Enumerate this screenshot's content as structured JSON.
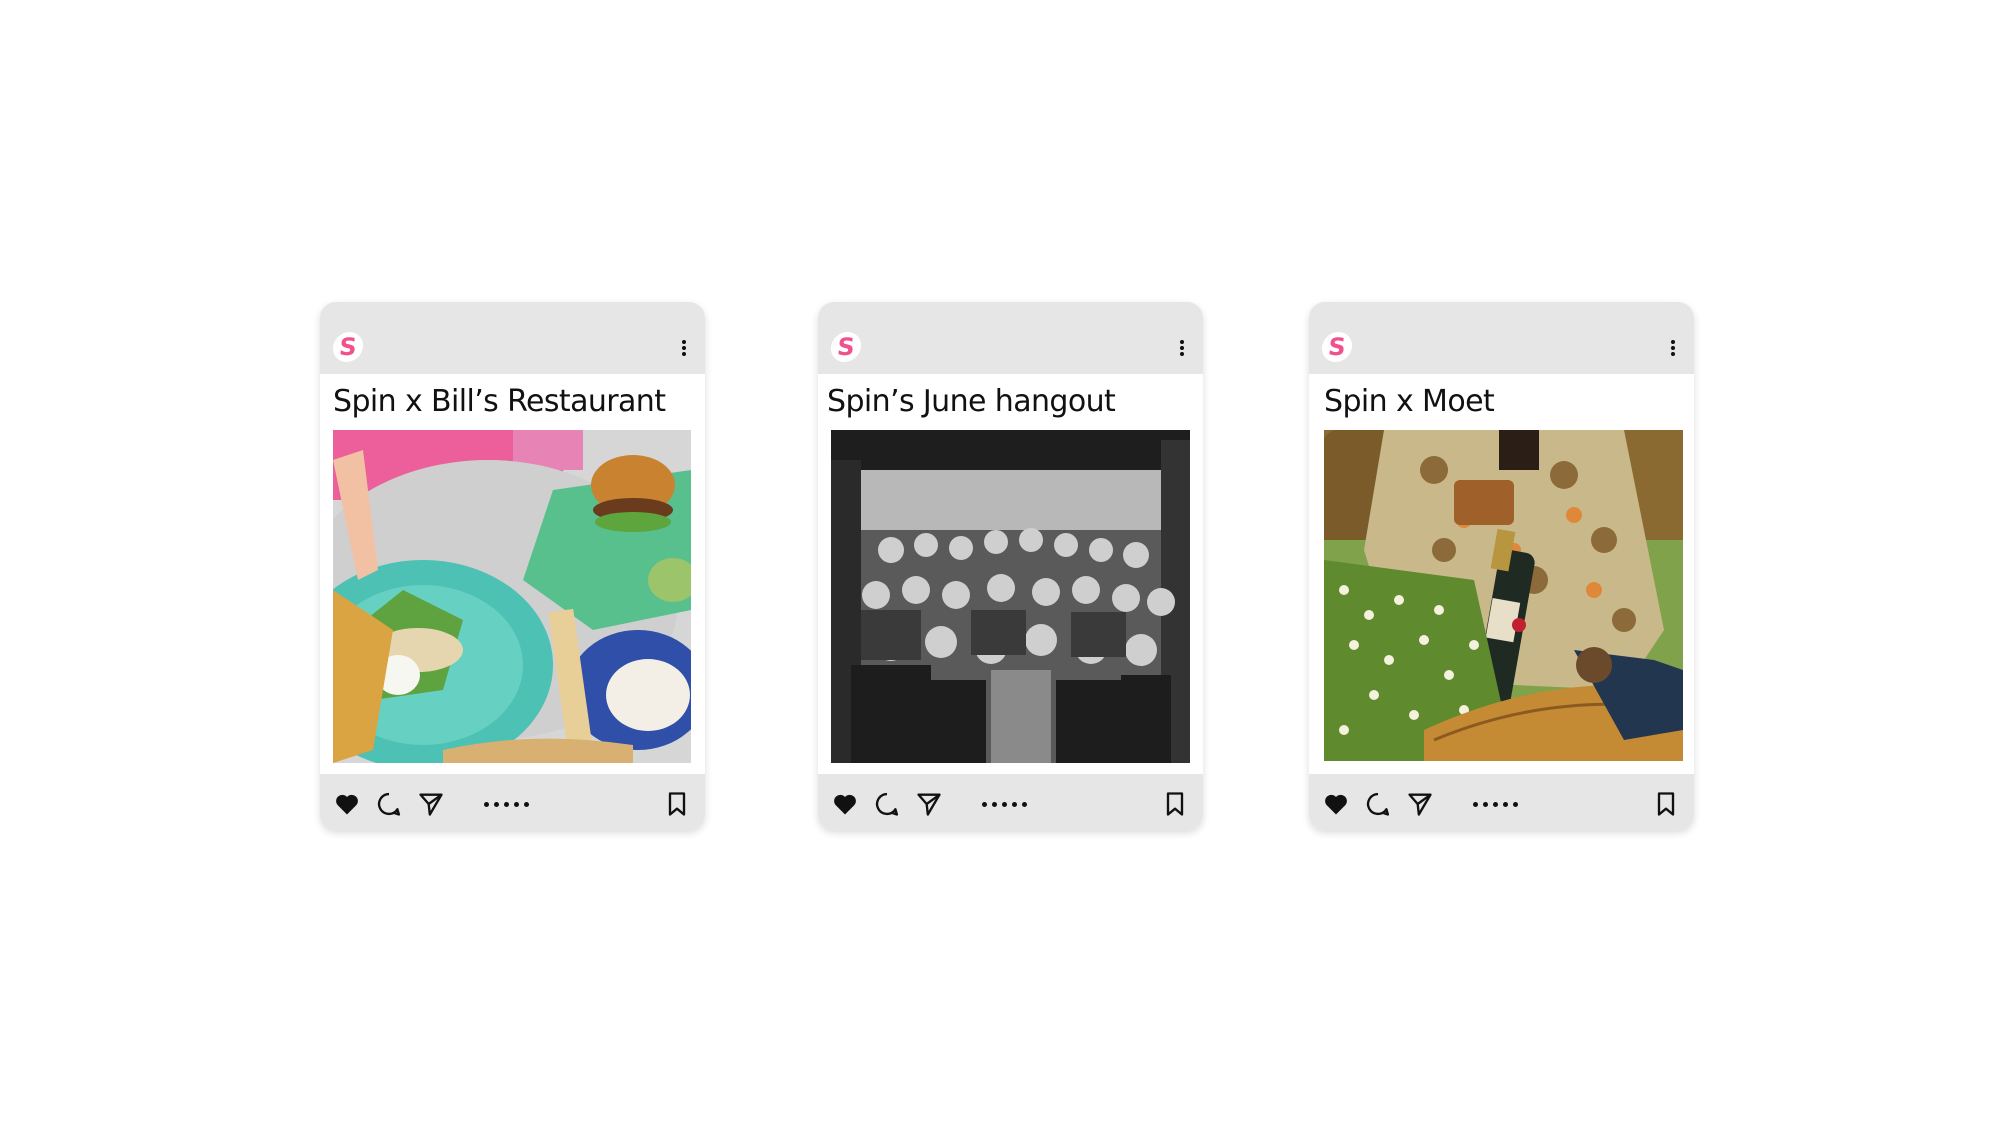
{
  "brand": {
    "logo_letter": "S",
    "logo_color": "#f0508c"
  },
  "posts": [
    {
      "title": "Spin x Bill’s Restaurant",
      "image": "food-table-photo"
    },
    {
      "title": "Spin’s June hangout",
      "image": "group-party-photo"
    },
    {
      "title": "Spin x Moet",
      "image": "champagne-flowers-photo"
    }
  ],
  "icons": {
    "like": "heart-icon",
    "comment": "comment-icon",
    "share": "send-icon",
    "carousel": "carousel-dots-icon",
    "save": "bookmark-icon",
    "more": "more-vertical-icon"
  }
}
